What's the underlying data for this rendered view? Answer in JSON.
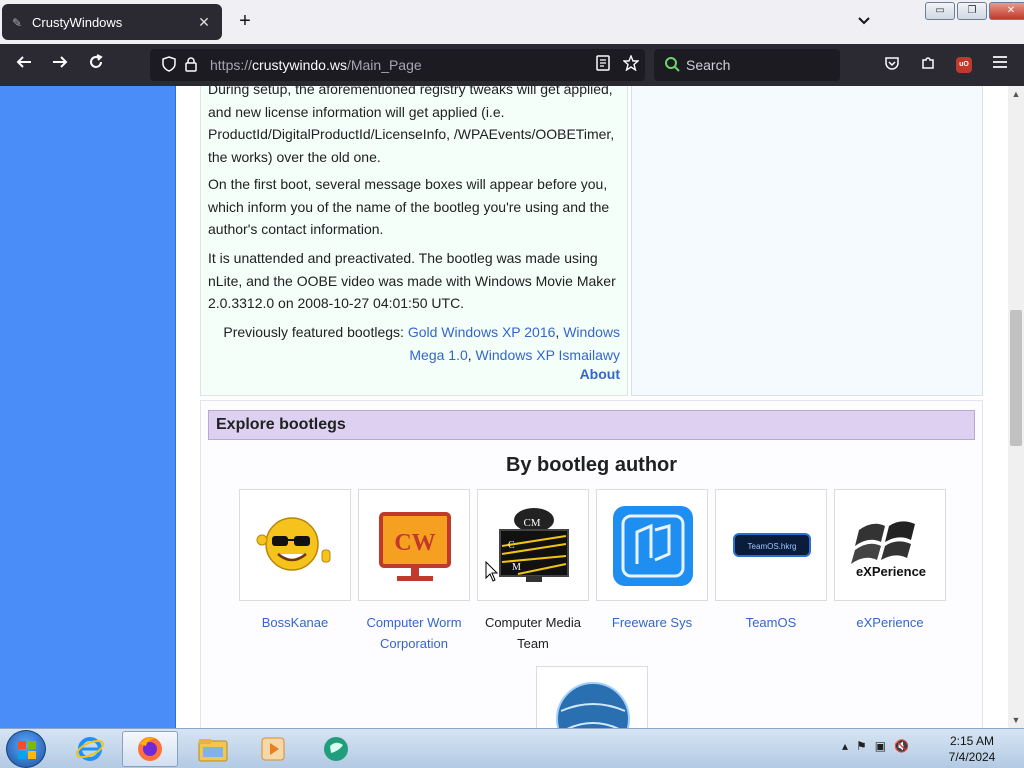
{
  "browser": {
    "tab_title": "CrustyWindows",
    "tab_close": "✕",
    "new_tab": "+",
    "all_tabs": "⌵",
    "url_scheme": "https://",
    "url_host": "crustywindo.ws",
    "url_path": "/Main_Page",
    "search_placeholder": "Search",
    "window_buttons": [
      "▭",
      "❐",
      "✕"
    ]
  },
  "article": {
    "paragraphs": [
      "During setup, the aforementioned registry tweaks will get applied, and new license information will get applied (i.e. ProductId/DigitalProductId/LicenseInfo, /WPAEvents/OOBETimer, the works) over the old one.",
      "On the first boot, several message boxes will appear before you, which inform you of the name of the bootleg you're using and the author's contact information.",
      "It is unattended and preactivated. The bootleg was made using nLite, and the OOBE video was made with Windows Movie Maker 2.0.3312.0 on 2008-10-27 04:01:50 UTC."
    ],
    "previously_label": "Previously featured bootlegs: ",
    "previous_links": [
      "Gold Windows XP 2016",
      "Windows Mega 1.0",
      "Windows XP Ismailawy"
    ],
    "about_label": "About"
  },
  "explore": {
    "heading": "Explore bootlegs",
    "section_title": "By bootleg author",
    "authors": [
      {
        "name": "BossKanae",
        "line2": ""
      },
      {
        "name": "Computer Worm",
        "line2": "Corporation"
      },
      {
        "name": "Computer Media",
        "line2": "Team"
      },
      {
        "name": "Freeware Sys",
        "line2": ""
      },
      {
        "name": "TeamOS",
        "line2": ""
      },
      {
        "name": "eXPerience",
        "line2": ""
      }
    ],
    "logo_text": {
      "cw": "CW",
      "cm_top": "CM",
      "cm_c": "C",
      "cm_m": "M",
      "teamos": "TeamOS.hkrg",
      "experience": "eXPerience"
    }
  },
  "taskbar": {
    "time": "2:15 AM",
    "date": "7/4/2024"
  },
  "colors": {
    "link": "#3366cc",
    "page_left_band": "#4b8df8",
    "explore_header": "#ddd0f0",
    "toolbar": "#2b2a33"
  }
}
